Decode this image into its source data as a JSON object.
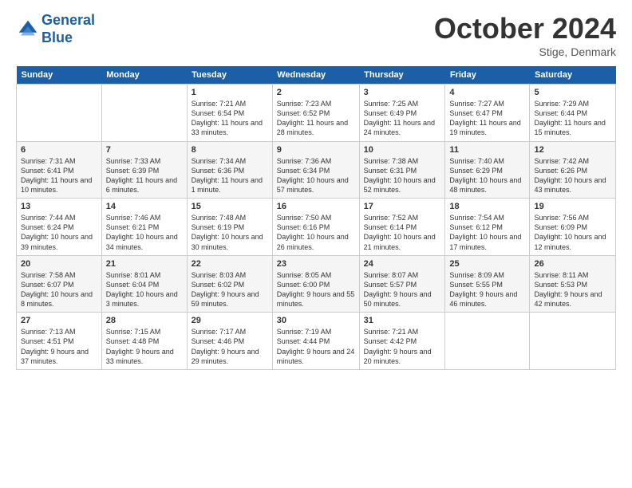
{
  "logo": {
    "line1": "General",
    "line2": "Blue"
  },
  "title": "October 2024",
  "subtitle": "Stige, Denmark",
  "header_days": [
    "Sunday",
    "Monday",
    "Tuesday",
    "Wednesday",
    "Thursday",
    "Friday",
    "Saturday"
  ],
  "weeks": [
    [
      {
        "day": "",
        "sunrise": "",
        "sunset": "",
        "daylight": ""
      },
      {
        "day": "",
        "sunrise": "",
        "sunset": "",
        "daylight": ""
      },
      {
        "day": "1",
        "sunrise": "Sunrise: 7:21 AM",
        "sunset": "Sunset: 6:54 PM",
        "daylight": "Daylight: 11 hours and 33 minutes."
      },
      {
        "day": "2",
        "sunrise": "Sunrise: 7:23 AM",
        "sunset": "Sunset: 6:52 PM",
        "daylight": "Daylight: 11 hours and 28 minutes."
      },
      {
        "day": "3",
        "sunrise": "Sunrise: 7:25 AM",
        "sunset": "Sunset: 6:49 PM",
        "daylight": "Daylight: 11 hours and 24 minutes."
      },
      {
        "day": "4",
        "sunrise": "Sunrise: 7:27 AM",
        "sunset": "Sunset: 6:47 PM",
        "daylight": "Daylight: 11 hours and 19 minutes."
      },
      {
        "day": "5",
        "sunrise": "Sunrise: 7:29 AM",
        "sunset": "Sunset: 6:44 PM",
        "daylight": "Daylight: 11 hours and 15 minutes."
      }
    ],
    [
      {
        "day": "6",
        "sunrise": "Sunrise: 7:31 AM",
        "sunset": "Sunset: 6:41 PM",
        "daylight": "Daylight: 11 hours and 10 minutes."
      },
      {
        "day": "7",
        "sunrise": "Sunrise: 7:33 AM",
        "sunset": "Sunset: 6:39 PM",
        "daylight": "Daylight: 11 hours and 6 minutes."
      },
      {
        "day": "8",
        "sunrise": "Sunrise: 7:34 AM",
        "sunset": "Sunset: 6:36 PM",
        "daylight": "Daylight: 11 hours and 1 minute."
      },
      {
        "day": "9",
        "sunrise": "Sunrise: 7:36 AM",
        "sunset": "Sunset: 6:34 PM",
        "daylight": "Daylight: 10 hours and 57 minutes."
      },
      {
        "day": "10",
        "sunrise": "Sunrise: 7:38 AM",
        "sunset": "Sunset: 6:31 PM",
        "daylight": "Daylight: 10 hours and 52 minutes."
      },
      {
        "day": "11",
        "sunrise": "Sunrise: 7:40 AM",
        "sunset": "Sunset: 6:29 PM",
        "daylight": "Daylight: 10 hours and 48 minutes."
      },
      {
        "day": "12",
        "sunrise": "Sunrise: 7:42 AM",
        "sunset": "Sunset: 6:26 PM",
        "daylight": "Daylight: 10 hours and 43 minutes."
      }
    ],
    [
      {
        "day": "13",
        "sunrise": "Sunrise: 7:44 AM",
        "sunset": "Sunset: 6:24 PM",
        "daylight": "Daylight: 10 hours and 39 minutes."
      },
      {
        "day": "14",
        "sunrise": "Sunrise: 7:46 AM",
        "sunset": "Sunset: 6:21 PM",
        "daylight": "Daylight: 10 hours and 34 minutes."
      },
      {
        "day": "15",
        "sunrise": "Sunrise: 7:48 AM",
        "sunset": "Sunset: 6:19 PM",
        "daylight": "Daylight: 10 hours and 30 minutes."
      },
      {
        "day": "16",
        "sunrise": "Sunrise: 7:50 AM",
        "sunset": "Sunset: 6:16 PM",
        "daylight": "Daylight: 10 hours and 26 minutes."
      },
      {
        "day": "17",
        "sunrise": "Sunrise: 7:52 AM",
        "sunset": "Sunset: 6:14 PM",
        "daylight": "Daylight: 10 hours and 21 minutes."
      },
      {
        "day": "18",
        "sunrise": "Sunrise: 7:54 AM",
        "sunset": "Sunset: 6:12 PM",
        "daylight": "Daylight: 10 hours and 17 minutes."
      },
      {
        "day": "19",
        "sunrise": "Sunrise: 7:56 AM",
        "sunset": "Sunset: 6:09 PM",
        "daylight": "Daylight: 10 hours and 12 minutes."
      }
    ],
    [
      {
        "day": "20",
        "sunrise": "Sunrise: 7:58 AM",
        "sunset": "Sunset: 6:07 PM",
        "daylight": "Daylight: 10 hours and 8 minutes."
      },
      {
        "day": "21",
        "sunrise": "Sunrise: 8:01 AM",
        "sunset": "Sunset: 6:04 PM",
        "daylight": "Daylight: 10 hours and 3 minutes."
      },
      {
        "day": "22",
        "sunrise": "Sunrise: 8:03 AM",
        "sunset": "Sunset: 6:02 PM",
        "daylight": "Daylight: 9 hours and 59 minutes."
      },
      {
        "day": "23",
        "sunrise": "Sunrise: 8:05 AM",
        "sunset": "Sunset: 6:00 PM",
        "daylight": "Daylight: 9 hours and 55 minutes."
      },
      {
        "day": "24",
        "sunrise": "Sunrise: 8:07 AM",
        "sunset": "Sunset: 5:57 PM",
        "daylight": "Daylight: 9 hours and 50 minutes."
      },
      {
        "day": "25",
        "sunrise": "Sunrise: 8:09 AM",
        "sunset": "Sunset: 5:55 PM",
        "daylight": "Daylight: 9 hours and 46 minutes."
      },
      {
        "day": "26",
        "sunrise": "Sunrise: 8:11 AM",
        "sunset": "Sunset: 5:53 PM",
        "daylight": "Daylight: 9 hours and 42 minutes."
      }
    ],
    [
      {
        "day": "27",
        "sunrise": "Sunrise: 7:13 AM",
        "sunset": "Sunset: 4:51 PM",
        "daylight": "Daylight: 9 hours and 37 minutes."
      },
      {
        "day": "28",
        "sunrise": "Sunrise: 7:15 AM",
        "sunset": "Sunset: 4:48 PM",
        "daylight": "Daylight: 9 hours and 33 minutes."
      },
      {
        "day": "29",
        "sunrise": "Sunrise: 7:17 AM",
        "sunset": "Sunset: 4:46 PM",
        "daylight": "Daylight: 9 hours and 29 minutes."
      },
      {
        "day": "30",
        "sunrise": "Sunrise: 7:19 AM",
        "sunset": "Sunset: 4:44 PM",
        "daylight": "Daylight: 9 hours and 24 minutes."
      },
      {
        "day": "31",
        "sunrise": "Sunrise: 7:21 AM",
        "sunset": "Sunset: 4:42 PM",
        "daylight": "Daylight: 9 hours and 20 minutes."
      },
      {
        "day": "",
        "sunrise": "",
        "sunset": "",
        "daylight": ""
      },
      {
        "day": "",
        "sunrise": "",
        "sunset": "",
        "daylight": ""
      }
    ]
  ]
}
